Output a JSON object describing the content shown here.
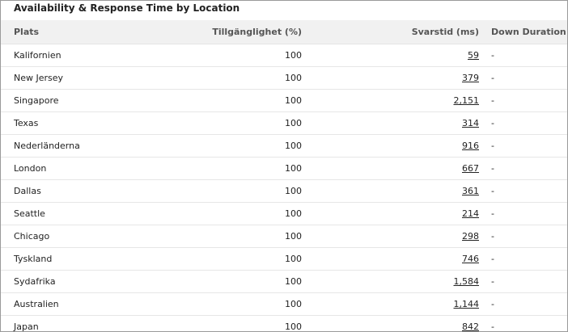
{
  "title": "Availability & Response Time by Location",
  "columns": {
    "location": "Plats",
    "availability": "Tillgänglighet (%)",
    "response": "Svarstid (ms)",
    "down": "Down Duration"
  },
  "rows": [
    {
      "location": "Kalifornien",
      "availability": "100",
      "response": "59",
      "down": "-"
    },
    {
      "location": "New Jersey",
      "availability": "100",
      "response": "379",
      "down": "-"
    },
    {
      "location": "Singapore",
      "availability": "100",
      "response": "2,151",
      "down": "-"
    },
    {
      "location": "Texas",
      "availability": "100",
      "response": "314",
      "down": "-"
    },
    {
      "location": "Nederländerna",
      "availability": "100",
      "response": "916",
      "down": "-"
    },
    {
      "location": "London",
      "availability": "100",
      "response": "667",
      "down": "-"
    },
    {
      "location": "Dallas",
      "availability": "100",
      "response": "361",
      "down": "-"
    },
    {
      "location": "Seattle",
      "availability": "100",
      "response": "214",
      "down": "-"
    },
    {
      "location": "Chicago",
      "availability": "100",
      "response": "298",
      "down": "-"
    },
    {
      "location": "Tyskland",
      "availability": "100",
      "response": "746",
      "down": "-"
    },
    {
      "location": "Sydafrika",
      "availability": "100",
      "response": "1,584",
      "down": "-"
    },
    {
      "location": "Australien",
      "availability": "100",
      "response": "1,144",
      "down": "-"
    },
    {
      "location": "Japan",
      "availability": "100",
      "response": "842",
      "down": "-"
    }
  ]
}
